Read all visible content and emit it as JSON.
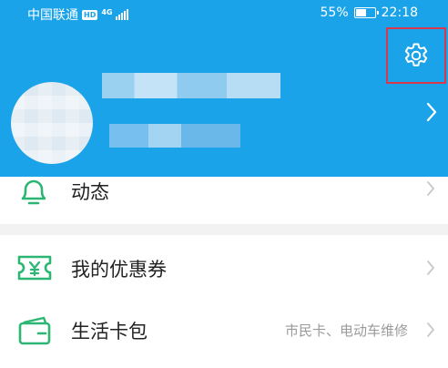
{
  "status_bar": {
    "carrier": "中国联通",
    "hd_badge": "HD",
    "network_type": "4G",
    "battery_percent": "55%",
    "battery_level": 0.55,
    "time": "22:18"
  },
  "header": {
    "background_color": "#1aa3e8",
    "settings_icon": "gear-icon",
    "highlight_color": "#d9374b"
  },
  "profile": {
    "name": "",
    "subtitle": ""
  },
  "menu": {
    "items": [
      {
        "label": "动态",
        "hint": "",
        "icon": "bell-icon"
      },
      {
        "label": "我的优惠券",
        "hint": "",
        "icon": "coupon-icon"
      },
      {
        "label": "生活卡包",
        "hint": "市民卡、电动车维修",
        "icon": "wallet-icon"
      }
    ],
    "icon_color": "#2bb673"
  }
}
